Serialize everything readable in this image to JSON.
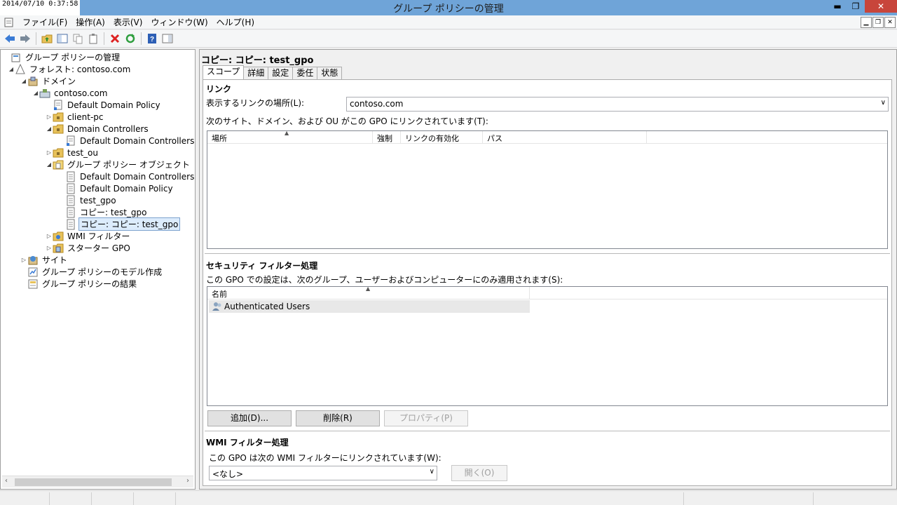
{
  "window": {
    "title": "グループ ポリシーの管理",
    "clock": "2014/07/10 0:37:58",
    "minimize": "▬",
    "restore": "❐",
    "close": "✕"
  },
  "menu": {
    "items": [
      "ファイル(F)",
      "操作(A)",
      "表示(V)",
      "ウィンドウ(W)",
      "ヘルプ(H)"
    ]
  },
  "tree": {
    "nodes": [
      {
        "label": "グループ ポリシーの管理",
        "icon": "gpmc-root-icon",
        "expander": ""
      },
      {
        "label": "フォレスト: contoso.com",
        "icon": "forest-icon",
        "expander": "◢"
      },
      {
        "label": "ドメイン",
        "icon": "domains-icon",
        "expander": "◢"
      },
      {
        "label": "contoso.com",
        "icon": "domain-icon",
        "expander": "◢"
      },
      {
        "label": "Default Domain Policy",
        "icon": "gpo-link-icon",
        "expander": ""
      },
      {
        "label": "client-pc",
        "icon": "ou-folder-icon",
        "expander": "▷"
      },
      {
        "label": "Domain Controllers",
        "icon": "ou-folder-icon",
        "expander": "◢"
      },
      {
        "label": "Default Domain Controllers Po",
        "icon": "gpo-link-icon",
        "expander": ""
      },
      {
        "label": "test_ou",
        "icon": "ou-folder-icon",
        "expander": "▷"
      },
      {
        "label": "グループ ポリシー オブジェクト",
        "icon": "gpo-container-icon",
        "expander": "◢"
      },
      {
        "label": "Default Domain Controllers Po",
        "icon": "gpo-icon",
        "expander": ""
      },
      {
        "label": "Default Domain Policy",
        "icon": "gpo-icon",
        "expander": ""
      },
      {
        "label": "test_gpo",
        "icon": "gpo-icon",
        "expander": ""
      },
      {
        "label": "コピー: test_gpo",
        "icon": "gpo-icon",
        "expander": ""
      },
      {
        "label": "コピー: コピー: test_gpo",
        "icon": "gpo-icon",
        "expander": ""
      },
      {
        "label": "WMI フィルター",
        "icon": "wmi-folder-icon",
        "expander": "▷"
      },
      {
        "label": "スターター GPO",
        "icon": "starter-gpo-icon",
        "expander": "▷"
      },
      {
        "label": "サイト",
        "icon": "sites-icon",
        "expander": "▷"
      },
      {
        "label": "グループ ポリシーのモデル作成",
        "icon": "modeling-icon",
        "expander": ""
      },
      {
        "label": "グループ ポリシーの結果",
        "icon": "results-icon",
        "expander": ""
      }
    ]
  },
  "details": {
    "title": "コピー: コピー: test_gpo",
    "tabs": [
      "スコープ",
      "詳細",
      "設定",
      "委任",
      "状態"
    ],
    "links": {
      "heading": "リンク",
      "location_label": "表示するリンクの場所(L):",
      "location_value": "contoso.com",
      "linked_label": "次のサイト、ドメイン、および OU がこの GPO にリンクされています(T):",
      "columns": [
        "場所",
        "強制",
        "リンクの有効化",
        "パス"
      ]
    },
    "security": {
      "heading": "セキュリティ フィルター処理",
      "description": "この GPO での設定は、次のグループ、ユーザーおよびコンピューターにのみ適用されます(S):",
      "column": "名前",
      "rows": [
        "Authenticated Users"
      ],
      "add": "追加(D)...",
      "remove": "削除(R)",
      "properties": "プロパティ(P)"
    },
    "wmi": {
      "heading": "WMI フィルター処理",
      "description": "この GPO は次の WMI フィルターにリンクされています(W):",
      "value": "<なし>",
      "open": "開く(O)"
    }
  }
}
